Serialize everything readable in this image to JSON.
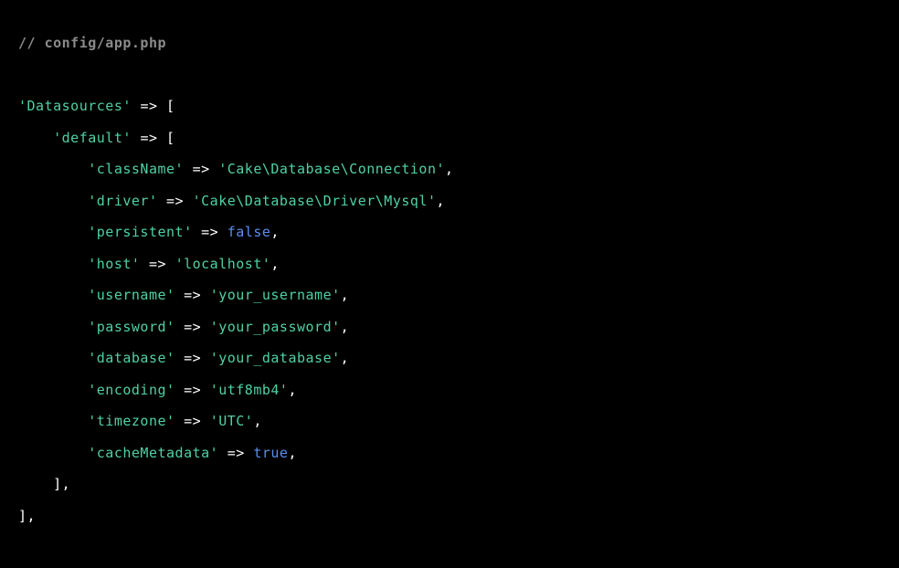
{
  "code": {
    "comment": "// config/app.php",
    "key_datasources": "'Datasources'",
    "arrow": "=>",
    "open_bracket": "[",
    "key_default": "'default'",
    "key_classname": "'className'",
    "val_classname": "'Cake\\Database\\Connection'",
    "key_driver": "'driver'",
    "val_driver": "'Cake\\Database\\Driver\\Mysql'",
    "key_persistent": "'persistent'",
    "val_persistent": "false",
    "key_host": "'host'",
    "val_host": "'localhost'",
    "key_username": "'username'",
    "val_username": "'your_username'",
    "key_password": "'password'",
    "val_password": "'your_password'",
    "key_database": "'database'",
    "val_database": "'your_database'",
    "key_encoding": "'encoding'",
    "val_encoding": "'utf8mb4'",
    "key_timezone": "'timezone'",
    "val_timezone": "'UTC'",
    "key_cachemetadata": "'cacheMetadata'",
    "val_cachemetadata": "true",
    "close_bracket": "]",
    "comma": ","
  }
}
